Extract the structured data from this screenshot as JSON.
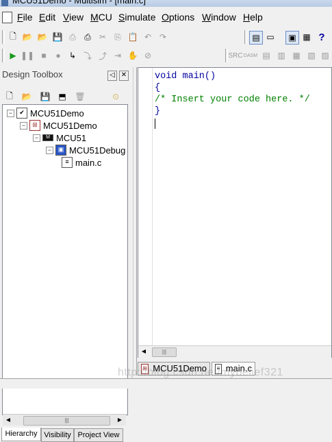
{
  "window": {
    "title": "MCU51Demo - Multisim - [main.c]"
  },
  "menu": [
    {
      "label": "File",
      "ul": "F",
      "rest": "ile"
    },
    {
      "label": "Edit",
      "ul": "E",
      "rest": "dit"
    },
    {
      "label": "View",
      "ul": "V",
      "rest": "iew"
    },
    {
      "label": "MCU",
      "ul": "M",
      "rest": "CU"
    },
    {
      "label": "Simulate",
      "ul": "S",
      "rest": "imulate"
    },
    {
      "label": "Options",
      "ul": "O",
      "rest": "ptions"
    },
    {
      "label": "Window",
      "ul": "W",
      "rest": "indow"
    },
    {
      "label": "Help",
      "ul": "H",
      "rest": "elp"
    }
  ],
  "toolbar_sim": {
    "src_label": "SRC",
    "dasm_label": "DASM"
  },
  "design_toolbox": {
    "title": "Design Toolbox",
    "tree": [
      {
        "label": "MCU51Demo",
        "level": 0,
        "icon": "checked-design-icon"
      },
      {
        "label": "MCU51Demo",
        "level": 1,
        "icon": "schematic-icon"
      },
      {
        "label": "MCU51",
        "level": 2,
        "icon": "mcu-chip-icon"
      },
      {
        "label": "MCU51Debug",
        "level": 3,
        "icon": "project-folder-icon"
      },
      {
        "label": "main.c",
        "level": 4,
        "icon": "c-file-icon"
      }
    ],
    "tabs": [
      "Hierarchy",
      "Visibility",
      "Project View"
    ],
    "active_tab": "Hierarchy"
  },
  "editor": {
    "lines": [
      {
        "text": "void main()",
        "style": "kw"
      },
      {
        "text": "{",
        "style": "kw"
      },
      {
        "text": "/* Insert your code here. */",
        "style": "cm"
      },
      {
        "text": "}",
        "style": "kw"
      }
    ]
  },
  "doc_tabs": [
    {
      "label": "MCU51Demo",
      "active": false,
      "icon": "schematic-icon"
    },
    {
      "label": "main.c",
      "active": true,
      "icon": "c-file-icon"
    }
  ],
  "watermark": "http://blog.csdn.net/mybelief321",
  "colors": {
    "keyword": "#0000a0",
    "comment": "#008000"
  }
}
